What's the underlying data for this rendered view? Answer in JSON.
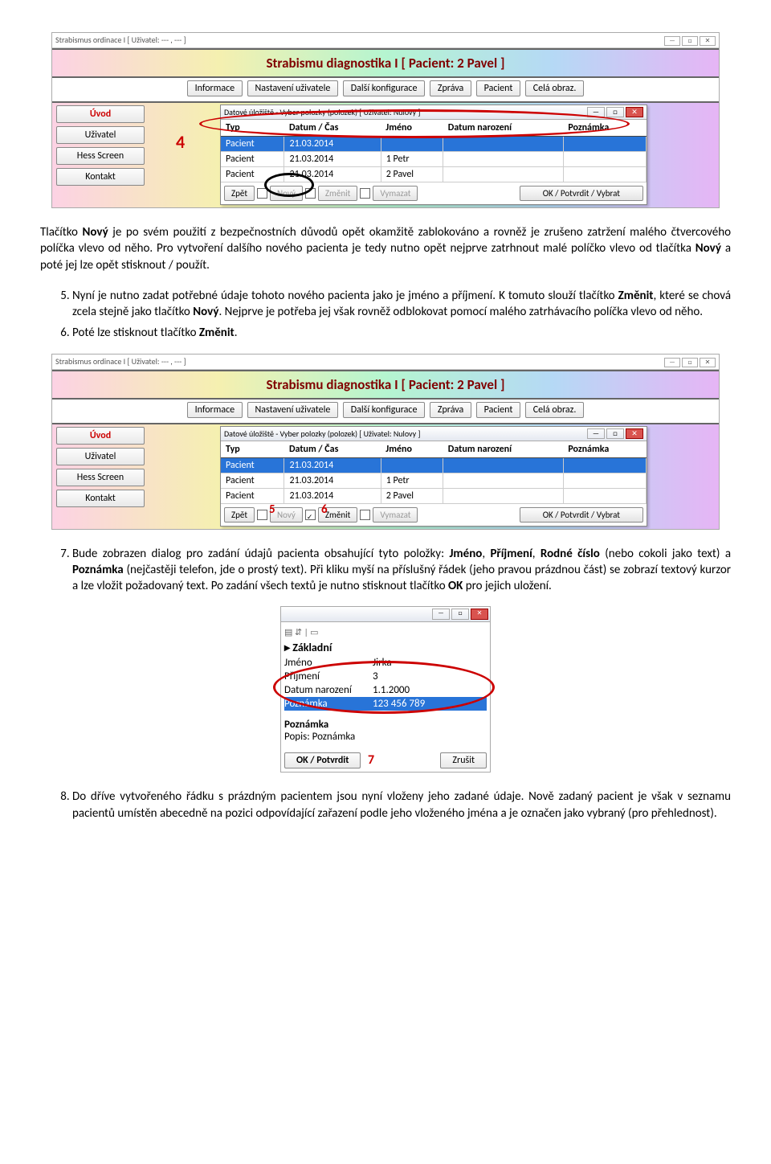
{
  "app": {
    "outer_title": "Strabismus ordinace I [ Uživatel: --- , --- ]",
    "header": "Strabismu diagnostika I [ Pacient: 2 Pavel ]",
    "nav": [
      "Informace",
      "Nastavení uživatele",
      "Další konfigurace",
      "Zpráva",
      "Pacient",
      "Celá obraz."
    ],
    "sidebar": [
      "Úvod",
      "Uživatel",
      "Hess Screen",
      "Kontakt"
    ],
    "inner_title": "Datové úložiště - Vyber polozky (polozek) [ Uživatel: Nulovy ]",
    "cols": [
      "Typ",
      "Datum / Čas",
      "Jméno",
      "Datum narození",
      "Poznámka"
    ],
    "rows": [
      {
        "typ": "Pacient",
        "datum": "21.03.2014",
        "jmeno": "",
        "nar": "",
        "pozn": ""
      },
      {
        "typ": "Pacient",
        "datum": "21.03.2014",
        "jmeno": "1 Petr",
        "nar": "",
        "pozn": ""
      },
      {
        "typ": "Pacient",
        "datum": "21.03.2014",
        "jmeno": "2 Pavel",
        "nar": "",
        "pozn": ""
      }
    ],
    "btns": {
      "zpet": "Zpět",
      "novy": "Nový",
      "zmenit": "Změnit",
      "vymazat": "Vymazat",
      "ok": "OK / Potvrdit / Vybrat"
    }
  },
  "annot": {
    "four": "4",
    "five": "5",
    "six": "6",
    "seven": "7"
  },
  "text": {
    "p1a": "Tlačítko ",
    "p1b": "Nový",
    "p1c": " je po svém použití z bezpečnostních důvodů opět okamžitě zablokováno a rovněž je zrušeno zatržení malého čtvercového políčka vlevo od něho. Pro vytvoření dalšího nového pacienta je tedy nutno opět nejprve zatrhnout malé políčko vlevo od tlačítka ",
    "p1d": "Nový",
    "p1e": " a poté jej lze opět stisknout / použít.",
    "li5a": "Nyní je nutno zadat potřebné údaje tohoto nového pacienta jako je jméno a příjmení. K tomuto slouží tlačítko ",
    "li5b": "Změnit",
    "li5c": ", které se chová zcela stejně jako tlačítko ",
    "li5d": "Nový",
    "li5e": ". Nejprve je potřeba jej však rovněž odblokovat pomocí malého zatrhávacího políčka vlevo od něho.",
    "li6a": "Poté lze stisknout tlačítko ",
    "li6b": "Změnit",
    "li6c": ".",
    "li7a": "Bude zobrazen dialog pro zadání údajů pacienta obsahující tyto položky: ",
    "li7b": "Jméno",
    "li7c": ", ",
    "li7d": "Příjmení",
    "li7e": ", ",
    "li7f": "Rodné číslo",
    "li7g": " (nebo cokoli jako text) a ",
    "li7h": "Poznámka",
    "li7i": " (nejčastěji telefon, jde o prostý text). Při kliku myší na příslušný řádek (jeho pravou prázdnou část) se zobrazí textový kurzor a lze vložit požadovaný text. Po zadání všech textů je nutno stisknout tlačítko ",
    "li7j": "OK",
    "li7k": " pro jejich uložení.",
    "li8": "Do dříve vytvořeného řádku s prázdným pacientem jsou nyní vloženy jeho zadané údaje. Nově zadaný pacient je však v seznamu pacientů umístěn abecedně na pozici odpovídající zařazení podle jeho vloženého jména a je označen jako vybraný (pro přehlednost)."
  },
  "dlg3": {
    "head": "Základní",
    "rows": [
      {
        "lbl": "Jméno",
        "val": "Jirka"
      },
      {
        "lbl": "Příjmení",
        "val": "3"
      },
      {
        "lbl": "Datum narození",
        "val": "1.1.2000"
      },
      {
        "lbl": "Poznámka",
        "val": "123 456 789"
      }
    ],
    "btm_h": "Poznámka",
    "btm_t": "Popis: Poznámka",
    "ok": "OK / Potvrdit",
    "cancel": "Zrušit"
  }
}
